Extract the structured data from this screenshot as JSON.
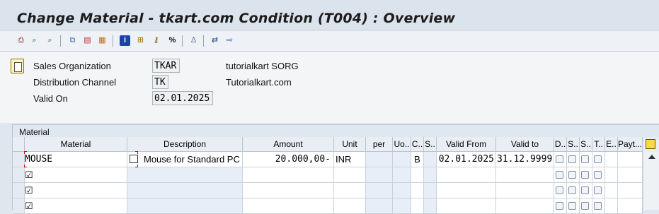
{
  "title": "Change Material - tkart.com Condition (T004) : Overview",
  "toolbar": {
    "icons": [
      "print-icon",
      "find-icon",
      "find-next-icon",
      "copy-icon",
      "details-icon",
      "gift-icon",
      "info-icon",
      "structure-icon",
      "key-icon",
      "percent-icon",
      "person-icon",
      "other-icon",
      "forward-icon"
    ]
  },
  "header": {
    "fields": [
      {
        "label": "Sales Organization",
        "value": "TKAR",
        "description": "tutorialkart SORG"
      },
      {
        "label": "Distribution Channel",
        "value": "TK",
        "description": "Tutorialkart.com"
      },
      {
        "label": "Valid On",
        "value": "02.01.2025",
        "description": ""
      }
    ]
  },
  "section": {
    "title": "Material"
  },
  "table": {
    "columns": [
      "Material",
      "Description",
      "Amount",
      "Unit",
      "per",
      "Uo..",
      "C..",
      "S..",
      "Valid From",
      "Valid to",
      "D..",
      "S..",
      "S..",
      "T..",
      "E..",
      "Payt..."
    ],
    "rows": [
      {
        "material": "MOUSE",
        "description": "Mouse for Standard PC",
        "amount": "20.000,00-",
        "unit": "INR",
        "per": "",
        "uom": "",
        "calc": "B",
        "scale": "",
        "valid_from": "02.01.2025",
        "valid_to": "31.12.9999"
      },
      {
        "material": "",
        "description": "",
        "amount": "",
        "unit": "",
        "per": "",
        "uom": "",
        "calc": "",
        "scale": "",
        "valid_from": "",
        "valid_to": ""
      },
      {
        "material": "",
        "description": "",
        "amount": "",
        "unit": "",
        "per": "",
        "uom": "",
        "calc": "",
        "scale": "",
        "valid_from": "",
        "valid_to": ""
      },
      {
        "material": "",
        "description": "",
        "amount": "",
        "unit": "",
        "per": "",
        "uom": "",
        "calc": "",
        "scale": "",
        "valid_from": "",
        "valid_to": ""
      }
    ]
  },
  "colors": {
    "title_bg": "#dbe3ec",
    "toolbar_bg": "#eef2f6",
    "grid_header": "#e9eef4",
    "grid_blue": "#e7eef7"
  }
}
